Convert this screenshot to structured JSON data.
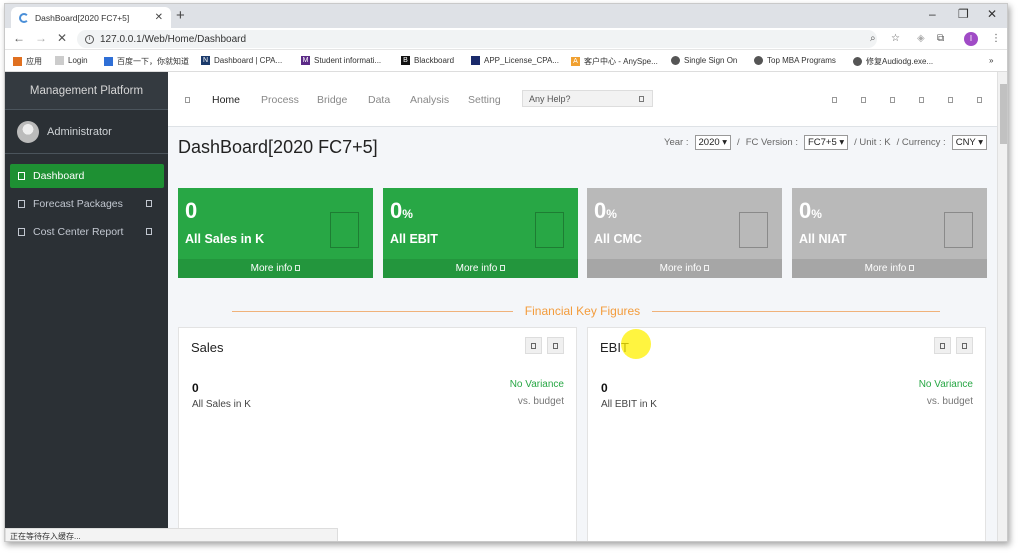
{
  "browser": {
    "tab_title": "DashBoard[2020 FC7+5]",
    "url": "127.0.0.1/Web/Home/Dashboard",
    "status_text": "正在等待存入缓存...",
    "bookmarks": [
      "应用",
      "Login",
      "百度一下，你就知道",
      "Dashboard | CPA...",
      "Student informati...",
      "Blackboard",
      "APP_License_CPA...",
      "客户中心 - AnySpe...",
      "Single Sign On",
      "Top MBA Programs",
      "修复Audiodg.exe..."
    ]
  },
  "app": {
    "brand": "Management Platform",
    "user": "Administrator",
    "sidebar": [
      "Dashboard",
      "Forecast Packages",
      "Cost Center Report"
    ],
    "topnav": [
      "Home",
      "Process",
      "Bridge",
      "Data",
      "Analysis",
      "Setting"
    ],
    "help_placeholder": "Any Help?",
    "page_title": "DashBoard[2020 FC7+5]",
    "filters": {
      "year_label": "Year :",
      "year": "2020 ▾",
      "sep": "/",
      "fc_label": "FC Version :",
      "fc": "FC7+5 ▾",
      "unit": "/ Unit : K",
      "currency_label": "/ Currency :",
      "currency": "CNY ▾"
    },
    "cards": [
      {
        "value": "0",
        "suffix": "",
        "label": "All Sales in K",
        "more": "More info"
      },
      {
        "value": "0",
        "suffix": "%",
        "label": "All EBIT",
        "more": "More info"
      },
      {
        "value": "0",
        "suffix": "%",
        "label": "All CMC",
        "more": "More info"
      },
      {
        "value": "0",
        "suffix": "%",
        "label": "All NIAT",
        "more": "More info"
      }
    ],
    "section_title": "Financial Key Figures",
    "panels": [
      {
        "title": "Sales",
        "value": "0",
        "sub": "All Sales in K",
        "variance": "No Variance",
        "vs": "vs. budget"
      },
      {
        "title": "EBIT",
        "value": "0",
        "sub": "All EBIT in K",
        "variance": "No Variance",
        "vs": "vs. budget"
      }
    ]
  },
  "colors": {
    "green": "#28a745",
    "grey": "#b9b9b9",
    "sidebar": "#2b3035",
    "accent": "#f39c3c"
  }
}
